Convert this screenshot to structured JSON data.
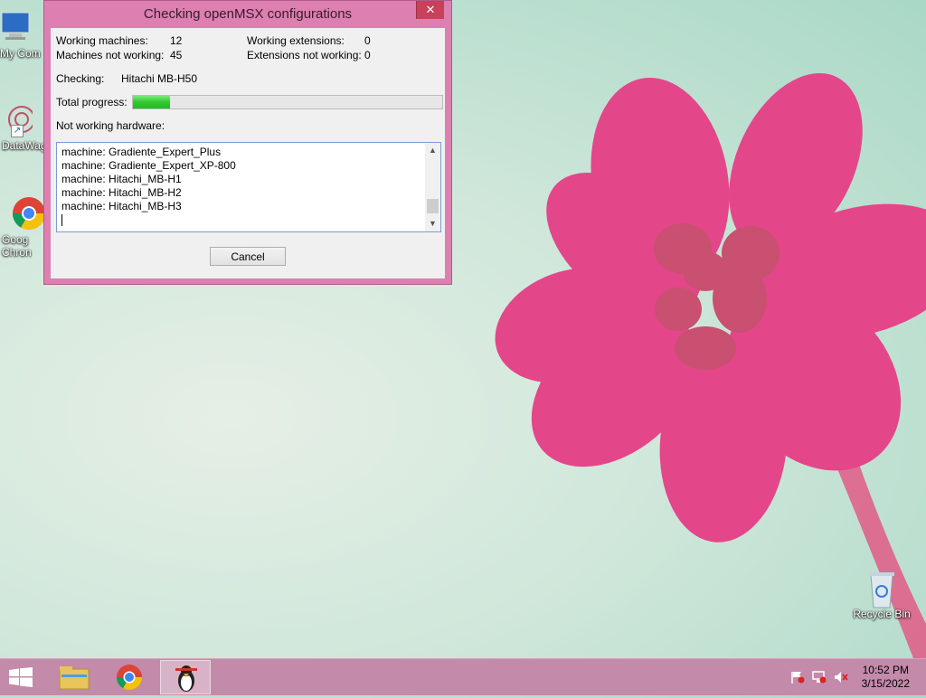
{
  "dialog": {
    "title": "Checking openMSX configurations",
    "close_glyph": "✕",
    "working_machines_label": "Working machines:",
    "working_machines_value": "12",
    "machines_not_working_label": "Machines not working:",
    "machines_not_working_value": "45",
    "working_extensions_label": "Working extensions:",
    "working_extensions_value": "0",
    "extensions_not_working_label": "Extensions not working:",
    "extensions_not_working_value": "0",
    "checking_label": "Checking:",
    "checking_value": "Hitachi MB-H50",
    "total_progress_label": "Total progress:",
    "total_progress_fraction": 0.12,
    "not_working_label": "Not working hardware:",
    "not_working_list": [
      "machine: Gradiente_Expert_Plus",
      "machine: Gradiente_Expert_XP-800",
      "machine: Hitachi_MB-H1",
      "machine: Hitachi_MB-H2",
      "machine: Hitachi_MB-H3"
    ],
    "cancel_label": "Cancel"
  },
  "desktop": {
    "icons": [
      {
        "label": "My Com",
        "icon": "computer-icon"
      },
      {
        "label": "DataWag",
        "icon": "datawag-icon"
      },
      {
        "label": "Goog",
        "label2": "Chron",
        "icon": "chrome-icon"
      },
      {
        "label": "Recycle Bin",
        "icon": "recycle-bin-icon"
      }
    ]
  },
  "taskbar": {
    "time": "10:52 PM",
    "date": "3/15/2022",
    "items": [
      "file-explorer-icon",
      "chrome-icon",
      "openmsx-catapult-icon"
    ]
  },
  "colors": {
    "window_frame": "#dd7fb0",
    "taskbar": "#c48aa9",
    "progress": "#2fc82f"
  }
}
